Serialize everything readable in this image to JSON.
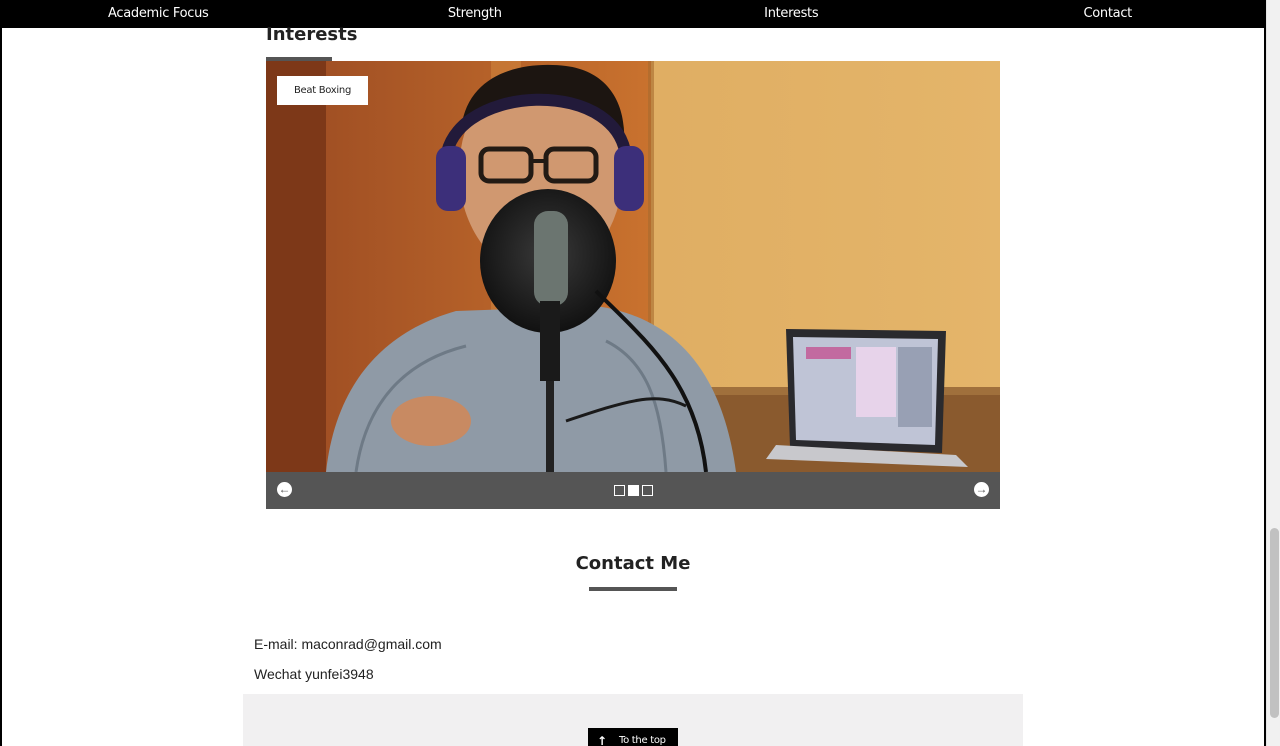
{
  "nav": {
    "items": [
      {
        "label": "Academic Focus"
      },
      {
        "label": "Strength"
      },
      {
        "label": "Interests"
      },
      {
        "label": "Contact"
      }
    ]
  },
  "interests": {
    "title": "Interests",
    "slider": {
      "caption": "Beat Boxing",
      "slide_count": 3,
      "active_index": 1
    }
  },
  "contact": {
    "title": "Contact Me",
    "email_line": "E-mail: maconrad@gmail.com",
    "wechat_line": "Wechat yunfei3948"
  },
  "footer": {
    "top_button_label": "To the top"
  },
  "colors": {
    "nav_bg": "#000000",
    "slider_bar": "#555555",
    "footer_bg": "#f1f0f1"
  }
}
